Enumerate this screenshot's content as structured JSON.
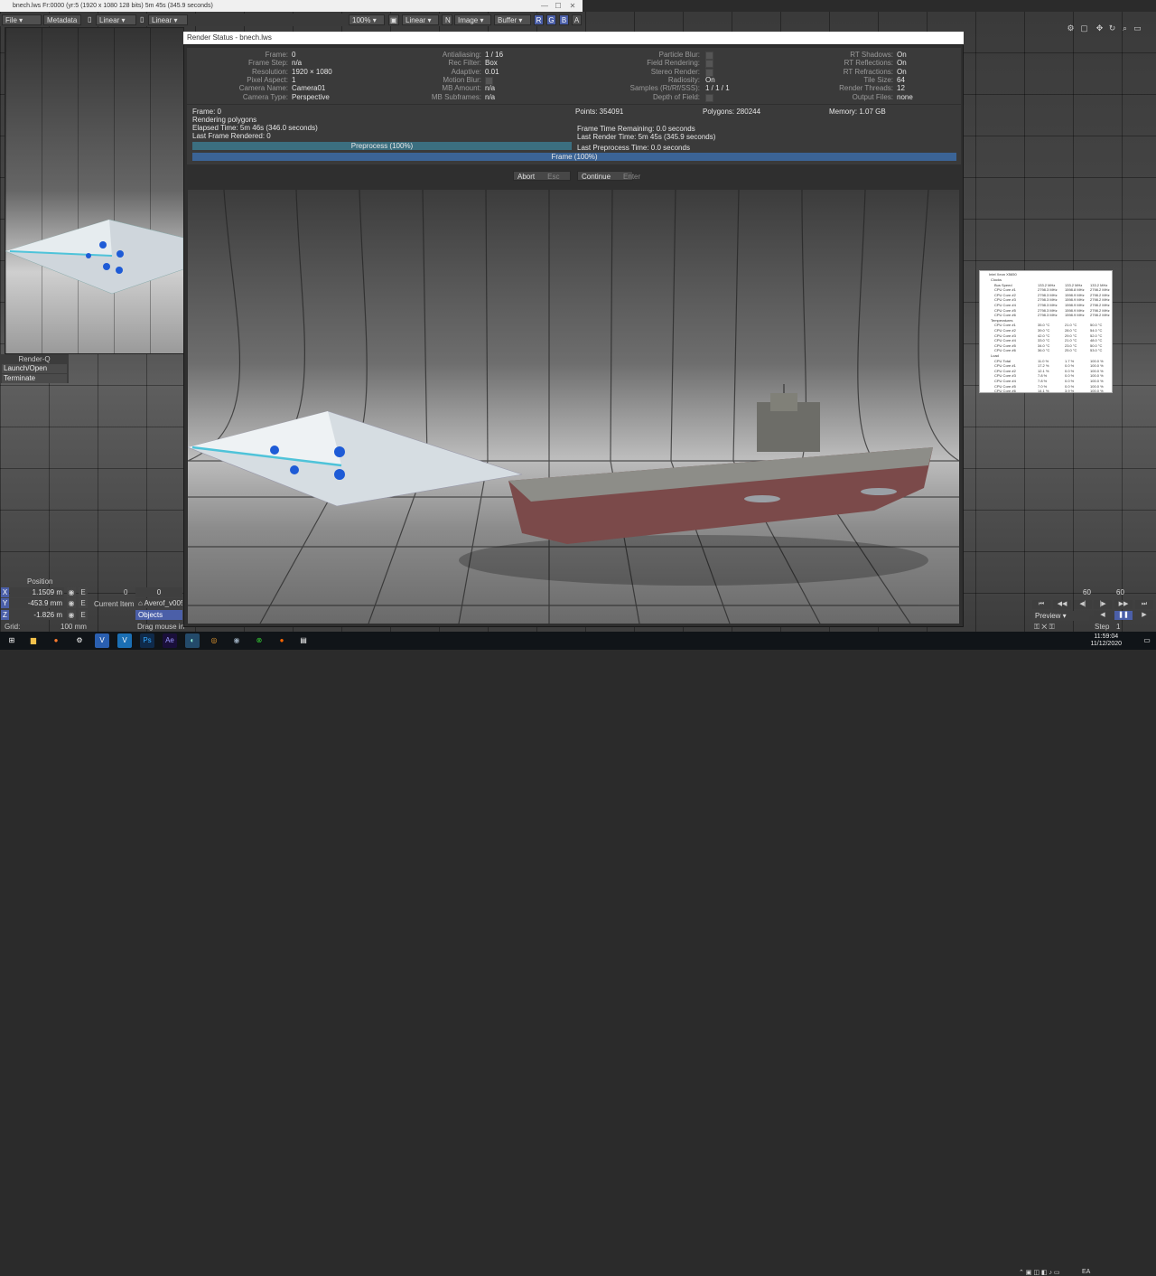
{
  "titlebar": {
    "title": "bnech.lws Fr:0000 (yr:5 (1920 x 1080 128 bits) 5m 45s (345.9 seconds)"
  },
  "toolbar": {
    "file": "File",
    "metadata": "Metadata",
    "linear1": "Linear",
    "linear2": "Linear",
    "zoom": "100%",
    "linear3": "Linear",
    "n": "N",
    "image": "Image",
    "buffer": "Buffer",
    "r": "R",
    "g": "G",
    "b": "B",
    "a": "A"
  },
  "render_status": {
    "title": "Render Status - bnech.lws",
    "col1": [
      {
        "label": "Frame:",
        "value": "0"
      },
      {
        "label": "Frame Step:",
        "value": "n/a"
      },
      {
        "label": "Resolution:",
        "value": "1920 × 1080"
      },
      {
        "label": "Pixel Aspect:",
        "value": "1"
      },
      {
        "label": "Camera Name:",
        "value": "Camera01"
      },
      {
        "label": "Camera Type:",
        "value": "Perspective"
      }
    ],
    "col2": [
      {
        "label": "Antialiasing:",
        "value": "1 / 16"
      },
      {
        "label": "Rec Filter:",
        "value": "Box"
      },
      {
        "label": "Adaptive:",
        "value": "0.01"
      },
      {
        "label": "Motion Blur:",
        "value": ""
      },
      {
        "label": "MB Amount:",
        "value": "n/a"
      },
      {
        "label": "MB Subframes:",
        "value": "n/a"
      }
    ],
    "col3": [
      {
        "label": "Particle Blur:",
        "value": ""
      },
      {
        "label": "Field Rendering:",
        "value": ""
      },
      {
        "label": "Stereo Render:",
        "value": ""
      },
      {
        "label": "Radiosity:",
        "value": "On"
      },
      {
        "label": "Samples (Rt/Rf/SSS):",
        "value": "1 / 1 / 1"
      },
      {
        "label": "Depth of Field:",
        "value": ""
      }
    ],
    "col4": [
      {
        "label": "RT Shadows:",
        "value": "On"
      },
      {
        "label": "RT Reflections:",
        "value": "On"
      },
      {
        "label": "RT Refractions:",
        "value": "On"
      },
      {
        "label": "Tile Size:",
        "value": "64"
      },
      {
        "label": "Render Threads:",
        "value": "12"
      },
      {
        "label": "Output Files:",
        "value": "none"
      }
    ],
    "progress": {
      "frame": "Frame: 0",
      "points": "Points: 354091",
      "polygons": "Polygons: 280244",
      "memory": "Memory: 1.07 GB",
      "stage": "Rendering polygons",
      "elapsed": "Elapsed Time: 5m 46s (346.0 seconds)",
      "last_frame": "Last Frame Rendered: 0",
      "remaining": "Frame Time Remaining: 0.0 seconds",
      "last_render": "Last Render Time: 5m 45s (345.9 seconds)",
      "last_preprocess": "Last Preprocess Time: 0.0 seconds",
      "preprocess_bar": "Preprocess (100%)",
      "preprocess_pct": 100,
      "frame_bar": "Frame (100%)",
      "frame_pct": 100
    },
    "abort": "Abort",
    "abort_key": "Esc",
    "continue": "Continue",
    "continue_key": "Enter"
  },
  "renderq": {
    "title": "Render-Q",
    "launch": "Launch/Open",
    "terminate": "Terminate"
  },
  "position": {
    "title": "Position",
    "x_label": "X",
    "x": "1.1509 m",
    "y_label": "Y",
    "y": "-453.9 mm",
    "z_label": "Z",
    "z": "-1.826 m",
    "grid_label": "Grid:",
    "grid": "100 mm",
    "e": "E",
    "frame_val": "0",
    "frame_val2": "0",
    "current_item_label": "Current Item",
    "current_item": "Averof_v005",
    "objects": "Objects",
    "hint": "Drag mouse in"
  },
  "timeline": {
    "n1": "60",
    "n2": "60",
    "preview": "Preview",
    "step_label": "Step",
    "step": "1"
  },
  "taskbar": {
    "time": "11:59:04",
    "date": "11/12/2020",
    "lang": "EA"
  },
  "hwmon": {
    "title": "Intel Xeon X5650",
    "rows": [
      [
        "Clocks",
        "",
        "",
        ""
      ],
      [
        "Bus Speed",
        "133.2 MHz",
        "133.2 MHz",
        "133.2 MHz"
      ],
      [
        "CPU Core #1",
        "2798.3 MHz",
        "1598.8 MHz",
        "2798.2 MHz"
      ],
      [
        "CPU Core #2",
        "2798.3 MHz",
        "1598.9 MHz",
        "2798.2 MHz"
      ],
      [
        "CPU Core #3",
        "2798.3 MHz",
        "1598.9 MHz",
        "2798.2 MHz"
      ],
      [
        "CPU Core #4",
        "2798.3 MHz",
        "1598.9 MHz",
        "2798.2 MHz"
      ],
      [
        "CPU Core #5",
        "2798.3 MHz",
        "1598.9 MHz",
        "2798.2 MHz"
      ],
      [
        "CPU Core #6",
        "2798.3 MHz",
        "1598.9 MHz",
        "2798.2 MHz"
      ],
      [
        "Temperatures",
        "",
        "",
        ""
      ],
      [
        "CPU Core #1",
        "35.0 °C",
        "21.0 °C",
        "50.0 °C"
      ],
      [
        "CPU Core #2",
        "39.0 °C",
        "28.0 °C",
        "54.0 °C"
      ],
      [
        "CPU Core #3",
        "42.0 °C",
        "29.0 °C",
        "52.0 °C"
      ],
      [
        "CPU Core #4",
        "33.0 °C",
        "21.0 °C",
        "48.0 °C"
      ],
      [
        "CPU Core #5",
        "34.0 °C",
        "23.0 °C",
        "50.0 °C"
      ],
      [
        "CPU Core #6",
        "36.0 °C",
        "25.0 °C",
        "53.0 °C"
      ],
      [
        "Load",
        "",
        "",
        ""
      ],
      [
        "CPU Total",
        "11.0 %",
        "1.7 %",
        "100.0 %"
      ],
      [
        "CPU Core #1",
        "17.2 %",
        "0.0 %",
        "100.0 %"
      ],
      [
        "CPU Core #2",
        "12.1 %",
        "0.0 %",
        "100.0 %"
      ],
      [
        "CPU Core #3",
        "7.8 %",
        "0.0 %",
        "100.0 %"
      ],
      [
        "CPU Core #4",
        "7.8 %",
        "0.0 %",
        "100.0 %"
      ],
      [
        "CPU Core #5",
        "7.0 %",
        "0.0 %",
        "100.0 %"
      ],
      [
        "CPU Core #6",
        "14.1 %",
        "3.9 %",
        "100.0 %"
      ]
    ]
  },
  "colors": {
    "accent": "#4b5fa8",
    "preprocess": "#3b6f80",
    "frame": "#3b6496"
  }
}
